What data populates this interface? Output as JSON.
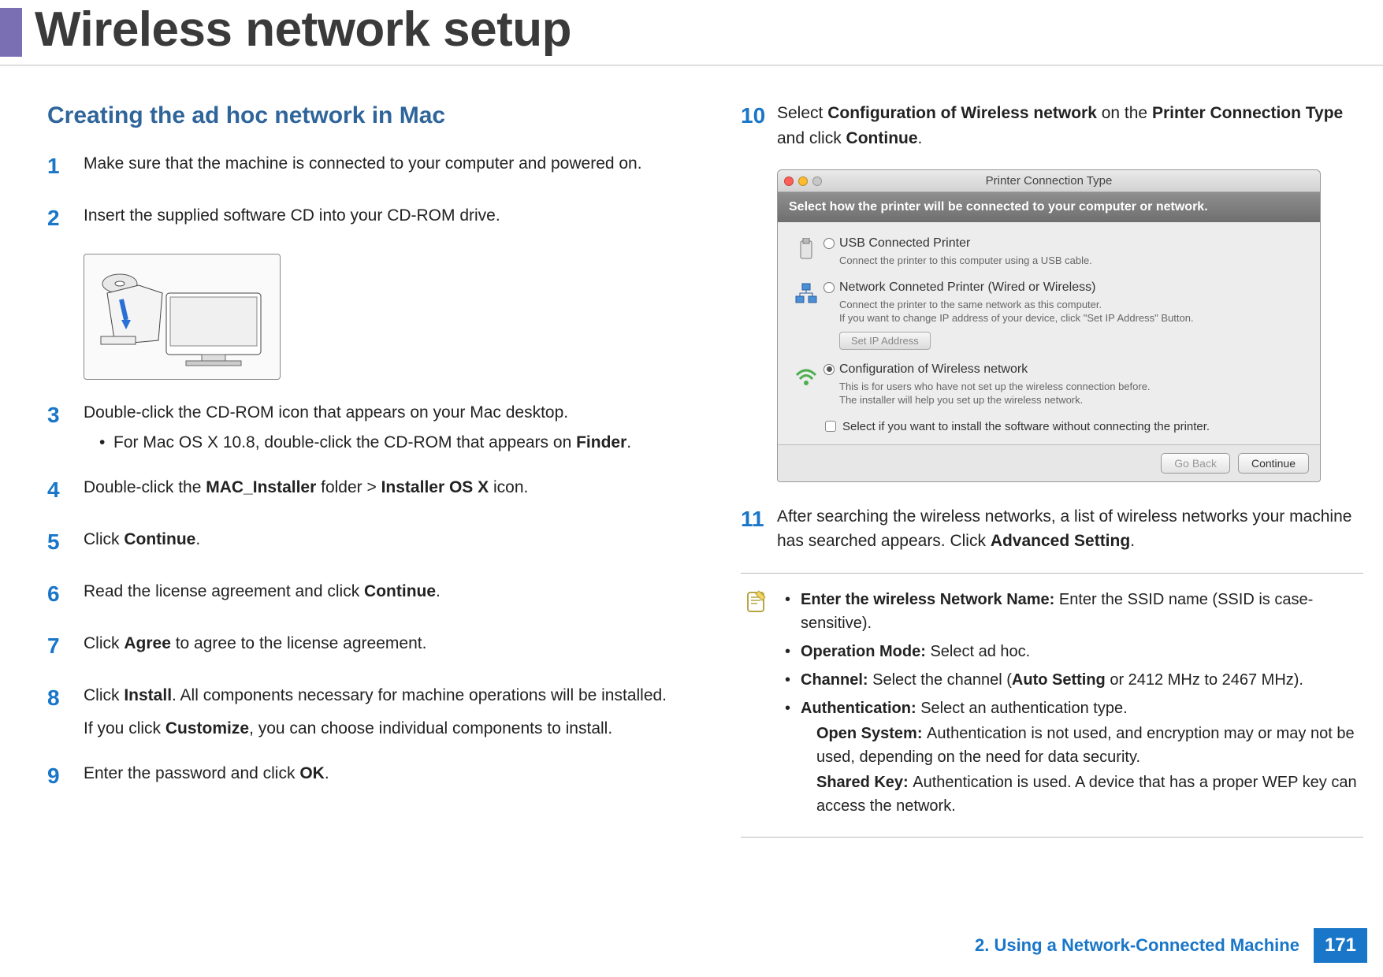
{
  "page": {
    "title": "Wireless network setup",
    "section_heading": "Creating the ad hoc network in Mac",
    "footer_chapter": "2.  Using a Network-Connected Machine",
    "page_number": "171"
  },
  "steps_left": [
    {
      "num": "1",
      "text": "Make sure that the machine is connected to your computer and powered on."
    },
    {
      "num": "2",
      "text": "Insert the supplied software CD into your CD-ROM drive."
    },
    {
      "num": "3",
      "text_pre": "Double-click the CD-ROM icon that appears on your Mac desktop.",
      "sub_pre": "For Mac OS X 10.8, double-click the CD-ROM that appears on ",
      "sub_bold": "Finder",
      "sub_post": "."
    },
    {
      "num": "4",
      "t1": "Double-click the ",
      "b1": "MAC_Installer",
      "t2": " folder > ",
      "b2": "Installer OS X",
      "t3": " icon."
    },
    {
      "num": "5",
      "t1": "Click ",
      "b1": "Continue",
      "t2": "."
    },
    {
      "num": "6",
      "t1": "Read the license agreement and click ",
      "b1": "Continue",
      "t2": "."
    },
    {
      "num": "7",
      "t1": "Click ",
      "b1": "Agree",
      "t2": " to agree to the license agreement."
    },
    {
      "num": "8",
      "t1": "Click ",
      "b1": "Install",
      "t2": ". All components necessary for machine operations will be installed.",
      "line2_t1": "If you click ",
      "line2_b1": "Customize",
      "line2_t2": ", you can choose individual components to install."
    },
    {
      "num": "9",
      "t1": "Enter the password and click ",
      "b1": "OK",
      "t2": "."
    }
  ],
  "steps_right": [
    {
      "num": "10",
      "t1": "Select ",
      "b1": "Configuration of Wireless network",
      "t2": " on the ",
      "b2": "Printer Connection Type",
      "t3": " and click ",
      "b3": "Continue",
      "t4": "."
    },
    {
      "num": "11",
      "t1": "After searching the wireless networks, a list of wireless networks your machine has searched appears. Click ",
      "b1": "Advanced Setting",
      "t2": "."
    }
  ],
  "dialog": {
    "title": "Printer Connection Type",
    "subtitle": "Select how the printer will be connected to your computer or network.",
    "opt1": {
      "label": "USB Connected Printer",
      "desc": "Connect the printer to this computer using a USB cable."
    },
    "opt2": {
      "label": "Network Conneted Printer (Wired or Wireless)",
      "desc1": "Connect the printer to the same network as this computer.",
      "desc2": "If you want to change IP address of your device, click \"Set IP Address\" Button.",
      "button": "Set IP Address"
    },
    "opt3": {
      "label": "Configuration of Wireless network",
      "desc1": "This is for users who have not set up the wireless connection before.",
      "desc2": "The installer will help you set up the wireless network."
    },
    "checkbox": "Select if you want to install the software without connecting the printer.",
    "btn_back": "Go Back",
    "btn_continue": "Continue"
  },
  "note": {
    "item1": {
      "bold": "Enter the wireless Network Name: ",
      "text": "Enter the SSID name (SSID is case-sensitive)."
    },
    "item2": {
      "bold": "Operation Mode: ",
      "text": "Select ad hoc."
    },
    "item3": {
      "bold": "Channel: ",
      "t1": "Select the channel (",
      "b1": "Auto Setting",
      "t2": " or 2412 MHz to 2467 MHz)."
    },
    "item4": {
      "bold": "Authentication: ",
      "text": "Select an authentication type.",
      "sub1_bold": "Open System: ",
      "sub1_text": "Authentication is not used, and encryption may or may not be used, depending on the need for data security.",
      "sub2_bold": "Shared Key: ",
      "sub2_text": "Authentication is used. A device that has a proper WEP key can access the network."
    }
  }
}
